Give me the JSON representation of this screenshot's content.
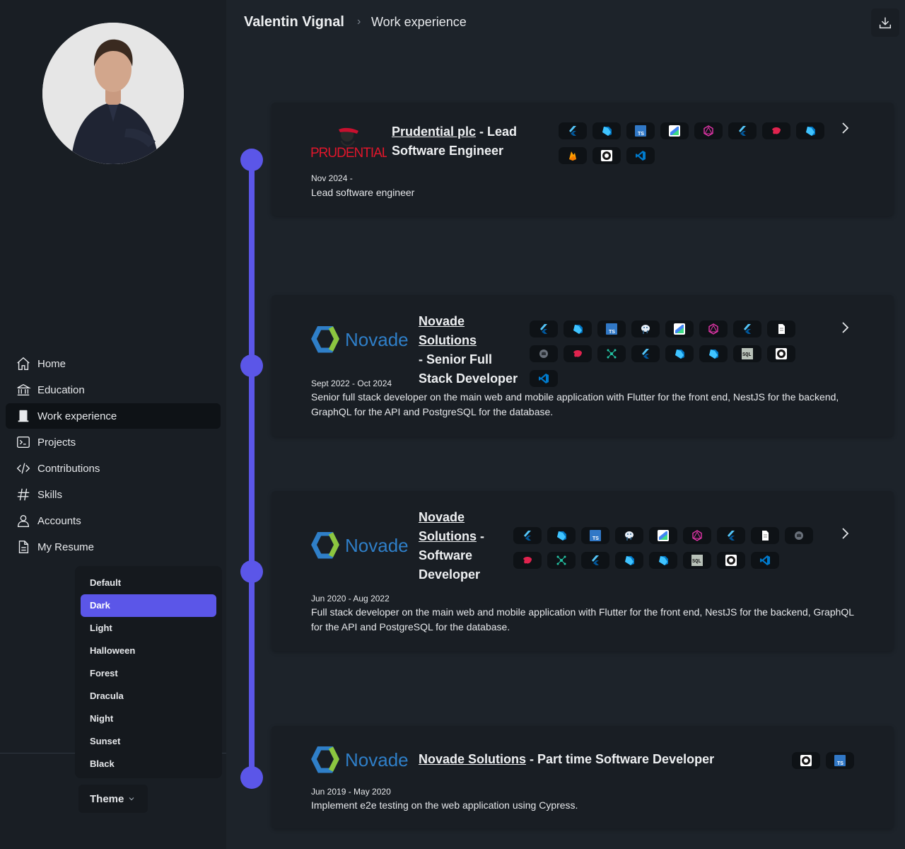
{
  "header": {
    "name": "Valentin Vignal",
    "separator": "›",
    "page": "Work experience"
  },
  "nav": {
    "items": [
      {
        "label": "Home",
        "icon": "home-icon"
      },
      {
        "label": "Education",
        "icon": "bank-icon"
      },
      {
        "label": "Work experience",
        "icon": "building-icon",
        "active": true
      },
      {
        "label": "Projects",
        "icon": "terminal-icon"
      },
      {
        "label": "Contributions",
        "icon": "code-icon"
      },
      {
        "label": "Skills",
        "icon": "hash-icon"
      },
      {
        "label": "Accounts",
        "icon": "user-icon"
      },
      {
        "label": "My Resume",
        "icon": "document-icon"
      }
    ]
  },
  "theme": {
    "button_label": "Theme",
    "selected": "Dark",
    "options": [
      "Default",
      "Dark",
      "Light",
      "Halloween",
      "Forest",
      "Dracula",
      "Night",
      "Sunset",
      "Black"
    ]
  },
  "colors": {
    "accent": "#5b56e8",
    "background": "#1d232a",
    "card": "#191e24"
  },
  "experiences": [
    {
      "logo": "Prudential",
      "company": "Prudential plc",
      "role_line1": " - Lead",
      "role_line2": "Software Engineer",
      "dates": "Nov 2024 -",
      "description": "Lead software engineer",
      "tech_icons": [
        "flutter-icon",
        "dart-icon",
        "typescript-icon",
        "android-studio-icon",
        "graphql-icon",
        "flutter-icon",
        "nestjs-icon",
        "dart-icon",
        "firebase-icon",
        "github-icon",
        "vscode-icon"
      ]
    },
    {
      "logo": "Novade",
      "company": "Novade Solutions",
      "role_line1": "- Senior Full",
      "role_line2": "Stack Developer",
      "dates": "Sept 2022 - Oct 2024",
      "description": "Senior full stack developer on the main web and mobile application with Flutter for the front end, NestJS for the backend, GraphQL for the API and PostgreSQL for the database.",
      "tech_icons": [
        "flutter-icon",
        "dart-icon",
        "typescript-icon",
        "postgresql-icon",
        "android-studio-icon",
        "graphql-icon",
        "flutter-icon",
        "file-icon",
        "cypress-icon",
        "nestjs-icon",
        "network-icon",
        "flutter-icon",
        "dart-icon",
        "dart-icon",
        "sql-icon",
        "github-icon",
        "vscode-icon"
      ]
    },
    {
      "logo": "Novade",
      "company_line1": "Novade",
      "company_line2": "Solutions",
      "role_suffix": " -",
      "role_line1": "Software",
      "role_line2": "Developer",
      "dates": "Jun 2020 - Aug 2022",
      "description": "Full stack developer on the main web and mobile application with Flutter for the front end, NestJS for the backend, GraphQL for the API and PostgreSQL for the database.",
      "tech_icons": [
        "flutter-icon",
        "dart-icon",
        "typescript-icon",
        "postgresql-icon",
        "android-studio-icon",
        "graphql-icon",
        "flutter-icon",
        "file-icon",
        "cypress-icon",
        "nestjs-icon",
        "network-icon",
        "flutter-icon",
        "dart-icon",
        "dart-icon",
        "sql-icon",
        "github-icon",
        "vscode-icon"
      ]
    },
    {
      "logo": "Novade",
      "company": "Novade Solutions",
      "role": " - Part time Software Developer",
      "dates": "Jun 2019 - May 2020",
      "description": "Implement e2e testing on the web application using Cypress.",
      "tech_icons": [
        "github-icon",
        "typescript-icon"
      ]
    }
  ],
  "logos": {
    "novade_text": "Novade",
    "prudential_text": "PRUDENTIAL"
  },
  "tech_text": {
    "ts": "TS",
    "sql": "SQL"
  }
}
